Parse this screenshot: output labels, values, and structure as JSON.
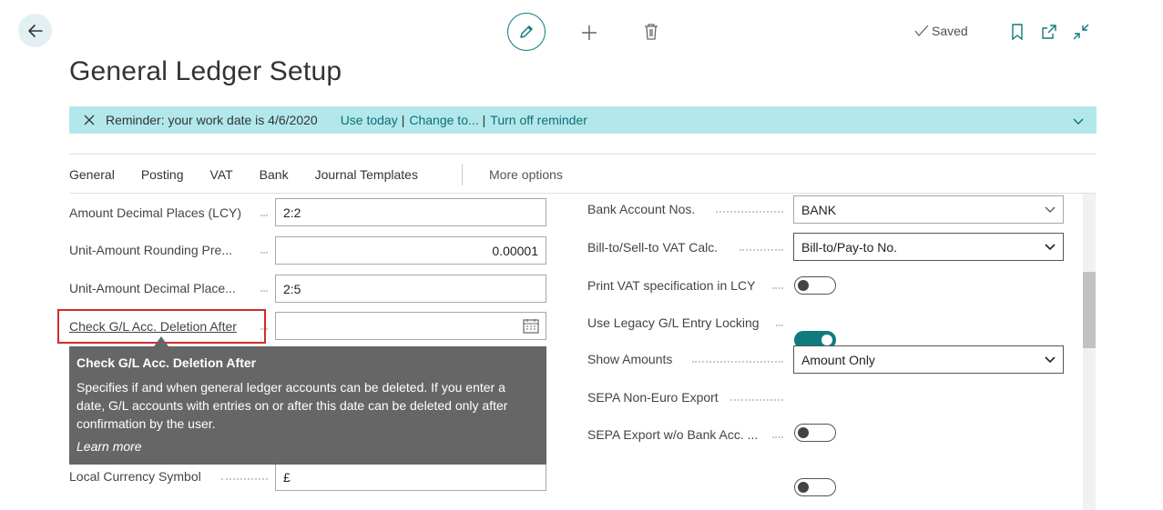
{
  "header": {
    "title": "General Ledger Setup",
    "saved_label": "Saved"
  },
  "reminder": {
    "message": "Reminder: your work date is 4/6/2020",
    "use_today": "Use today",
    "change_to": "Change to...",
    "turn_off": "Turn off reminder",
    "separator": "|"
  },
  "tabs": [
    "General",
    "Posting",
    "VAT",
    "Bank",
    "Journal Templates"
  ],
  "more_options": "More options",
  "left_fields": {
    "amount_decimal": {
      "label": "Amount Decimal Places (LCY)",
      "value": "2:2"
    },
    "unit_rounding": {
      "label": "Unit-Amount Rounding Pre...",
      "value": "0.00001"
    },
    "unit_decimal": {
      "label": "Unit-Amount Decimal Place...",
      "value": "2:5"
    },
    "check_deletion": {
      "label": "Check G/L Acc. Deletion After",
      "value": ""
    },
    "local_currency": {
      "label": "Local Currency Symbol",
      "value": "£"
    }
  },
  "right_fields": {
    "bank_account_nos": {
      "label": "Bank Account Nos.",
      "value": "BANK"
    },
    "bill_to_calc": {
      "label": "Bill-to/Sell-to VAT Calc.",
      "value": "Bill-to/Pay-to No."
    },
    "print_vat": {
      "label": "Print VAT specification in LCY",
      "value": false
    },
    "legacy_locking": {
      "label": "Use Legacy G/L Entry Locking",
      "value": true
    },
    "show_amounts": {
      "label": "Show Amounts",
      "value": "Amount Only"
    },
    "sepa_non_euro": {
      "label": "SEPA Non-Euro Export",
      "value": false
    },
    "sepa_wo_bank": {
      "label": "SEPA Export w/o Bank Acc. ...",
      "value": false
    }
  },
  "tooltip": {
    "title": "Check G/L Acc. Deletion After",
    "body": "Specifies if and when general ledger accounts can be deleted. If you enter a date, G/L accounts with entries on or after this date can be deleted only after confirmation by the user.",
    "learn_more": "Learn more"
  },
  "colors": {
    "accent": "#0f7b7f",
    "banner": "#b2e8ec",
    "tooltip_bg": "#666666",
    "highlight": "#d42a2a"
  }
}
